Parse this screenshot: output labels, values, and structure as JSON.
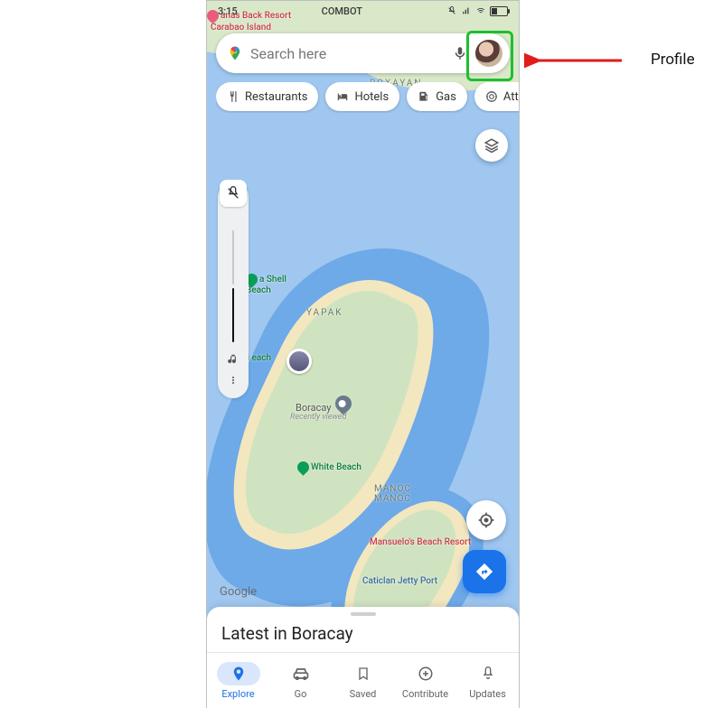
{
  "status_bar": {
    "time": "3:15",
    "carrier": "COMBOT"
  },
  "search": {
    "placeholder": "Search here"
  },
  "chips": [
    {
      "icon": "restaurant",
      "label": "Restaurants"
    },
    {
      "icon": "hotel",
      "label": "Hotels"
    },
    {
      "icon": "gas",
      "label": "Gas"
    },
    {
      "icon": "attraction",
      "label": "Attrac"
    }
  ],
  "map": {
    "watermark": "Google",
    "region_labels": {
      "top": "ROXAYAN",
      "yapak": "YAPAK",
      "manoc": "MANOC -\nMANOC"
    },
    "places": {
      "carabao": "Carabao Island",
      "banana_resort": "anas Back Resort",
      "puka": "a Shell\nBeach",
      "diniwid": "Di   each",
      "boracay": "Boracay",
      "boracay_sub": "Recently viewed",
      "white": "White Beach",
      "mansuelo": "Mansuelo's Beach Resort",
      "jetty": "Caticlan Jetty Port"
    }
  },
  "sheet": {
    "title": "Latest in Boracay"
  },
  "nav": {
    "items": [
      {
        "key": "explore",
        "label": "Explore",
        "active": true
      },
      {
        "key": "go",
        "label": "Go"
      },
      {
        "key": "saved",
        "label": "Saved"
      },
      {
        "key": "contribute",
        "label": "Contribute"
      },
      {
        "key": "updates",
        "label": "Updates"
      }
    ]
  },
  "annotation": {
    "label": "Profile"
  }
}
